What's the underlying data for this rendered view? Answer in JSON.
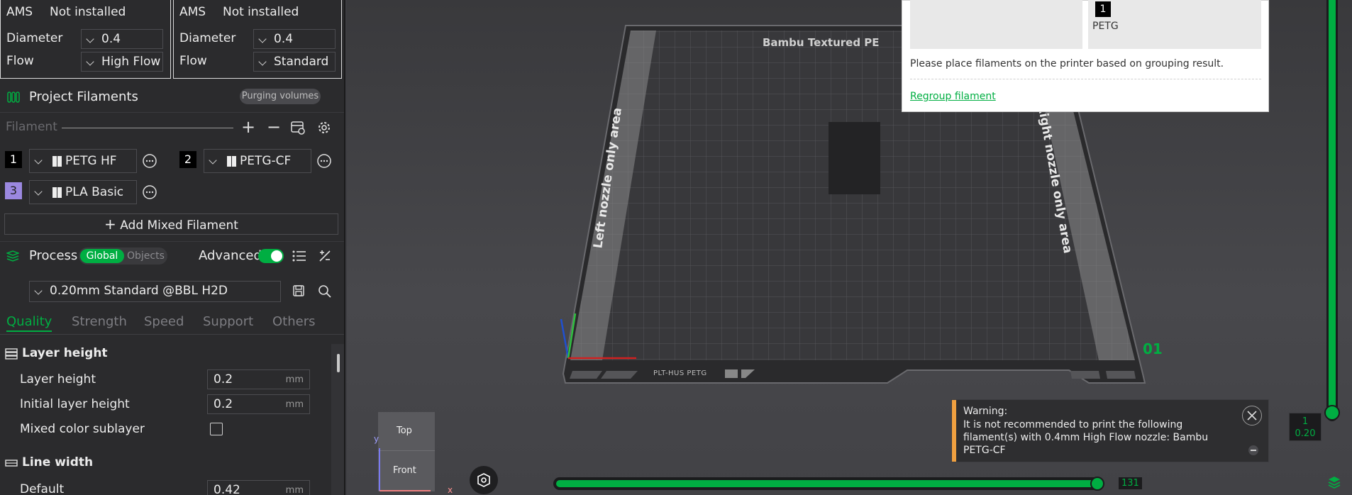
{
  "ams_left": {
    "ams_label": "AMS",
    "ams_value": "Not installed",
    "diameter_label": "Diameter",
    "diameter_value": "0.4",
    "flow_label": "Flow",
    "flow_value": "High Flow"
  },
  "ams_right": {
    "ams_label": "AMS",
    "ams_value": "Not installed",
    "diameter_label": "Diameter",
    "diameter_value": "0.4",
    "flow_label": "Flow",
    "flow_value": "Standard"
  },
  "project_filaments": {
    "title": "Project Filaments",
    "purging_button": "Purging volumes",
    "filament_label": "Filament",
    "items": [
      {
        "num": "1",
        "name": "PETG HF",
        "color": "#000000"
      },
      {
        "num": "2",
        "name": "PETG-CF",
        "color": "#000000"
      },
      {
        "num": "3",
        "name": "PLA Basic",
        "color": "#9b88e0"
      }
    ],
    "add_mixed": "Add Mixed Filament"
  },
  "process": {
    "title": "Process",
    "toggle_global": "Global",
    "toggle_objects": "Objects",
    "advanced_label": "Advanced",
    "preset": "0.20mm Standard @BBL H2D",
    "tabs": [
      "Quality",
      "Strength",
      "Speed",
      "Support",
      "Others"
    ],
    "groups": [
      {
        "title": "Layer height",
        "rows": [
          {
            "label": "Layer height",
            "value": "0.2",
            "unit": "mm"
          },
          {
            "label": "Initial layer height",
            "value": "0.2",
            "unit": "mm"
          },
          {
            "label": "Mixed color sublayer",
            "value": "",
            "unit": ""
          }
        ]
      },
      {
        "title": "Line width",
        "rows": [
          {
            "label": "Default",
            "value": "0.42",
            "unit": "mm"
          }
        ]
      }
    ]
  },
  "viewport": {
    "plate_title": "Bambu Textured PE",
    "left_area": "Left nozzle only area",
    "right_area": "Right nozzle only area",
    "plate_number": "01",
    "plate_tag": "PLT-HUS PETG",
    "view_top": "Top",
    "view_front": "Front",
    "axis_y": "y",
    "axis_x": "x",
    "slider_value": "131",
    "layer_top": "1",
    "layer_height": "0.20",
    "progress": 1.0
  },
  "grouping_popup": {
    "slot_num": "1",
    "slot_material": "PETG",
    "message": "Please place filaments on the printer based on grouping result.",
    "regroup_link": "Regroup filament"
  },
  "warning": {
    "title": "Warning:",
    "body": "It is not recommended to print the following filament(s) with 0.4mm High Flow nozzle: Bambu PETG-CF"
  },
  "colors": {
    "accent": "#00ae42",
    "link": "#00ae42",
    "warning": "#f0a040"
  }
}
